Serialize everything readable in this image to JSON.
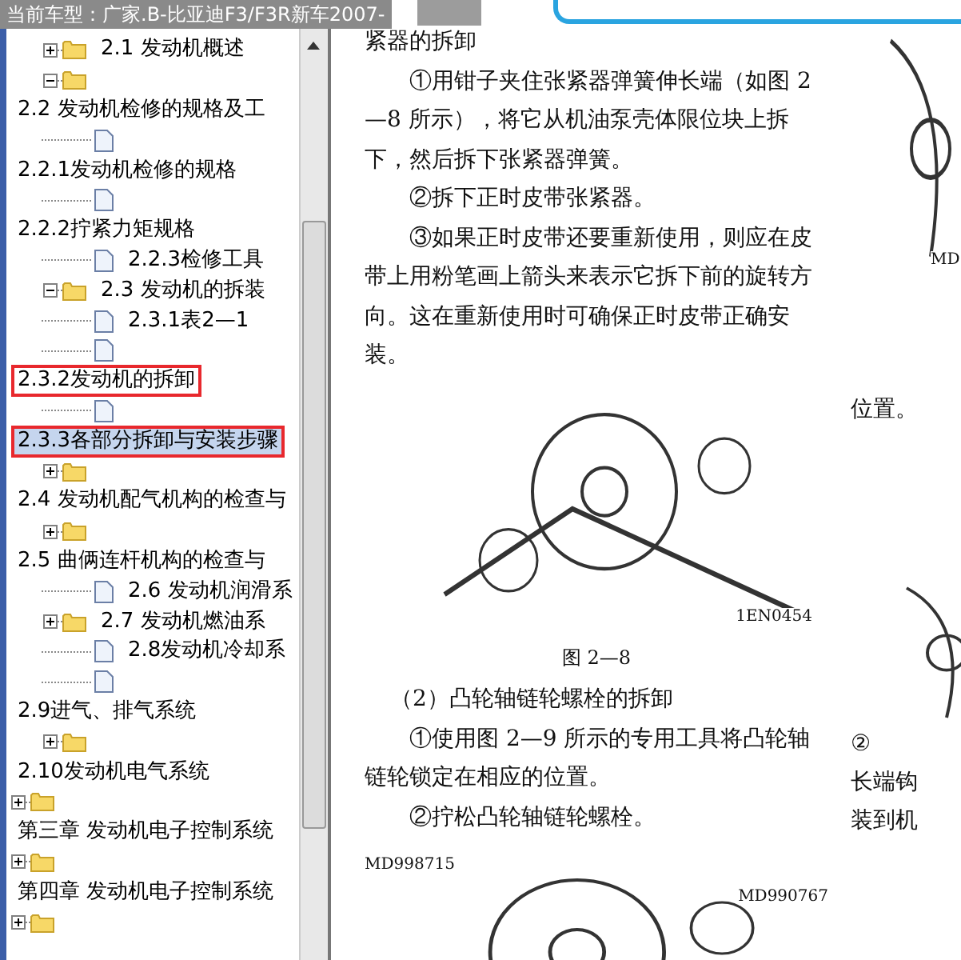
{
  "title_bar": {
    "text": "当前车型：广家.B-比亚迪F3/F3R新车2007-"
  },
  "tree": {
    "rows": [
      {
        "kind": "folder",
        "expanded": false,
        "label": "2.1 发动机概述",
        "selected": false
      },
      {
        "kind": "folder",
        "expanded": true
      },
      {
        "kind": "label",
        "label": "2.2 发动机检修的规格及工",
        "selected": false,
        "outlined": false
      },
      {
        "kind": "doc"
      },
      {
        "kind": "label",
        "label": "2.2.1发动机检修的规格",
        "selected": false,
        "outlined": false
      },
      {
        "kind": "doc"
      },
      {
        "kind": "label",
        "label": "2.2.2拧紧力矩规格",
        "selected": false,
        "outlined": false
      },
      {
        "kind": "doc",
        "label": "2.2.3检修工具",
        "selected": false
      },
      {
        "kind": "folder",
        "expanded": true,
        "label": "2.3 发动机的拆装",
        "selected": false
      },
      {
        "kind": "doc",
        "label": "2.3.1表2—1",
        "selected": false
      },
      {
        "kind": "doc"
      },
      {
        "kind": "label",
        "label": "2.3.2发动机的拆卸",
        "selected": false,
        "outlined": true
      },
      {
        "kind": "doc"
      },
      {
        "kind": "label",
        "label": "2.3.3各部分拆卸与安装步骤",
        "selected": true,
        "outlined": true
      },
      {
        "kind": "folder",
        "expanded": false
      },
      {
        "kind": "label",
        "label": "2.4 发动机配气机构的检查与",
        "selected": false,
        "outlined": false
      },
      {
        "kind": "folder",
        "expanded": false
      },
      {
        "kind": "label",
        "label": "2.5 曲俩连杆机构的检查与",
        "selected": false,
        "outlined": false
      },
      {
        "kind": "doc",
        "label": "2.6 发动机润滑系",
        "selected": false
      },
      {
        "kind": "folder",
        "expanded": false,
        "label": "2.7 发动机燃油系",
        "selected": false
      },
      {
        "kind": "doc",
        "label": "2.8发动机冷却系",
        "selected": false
      },
      {
        "kind": "doc"
      },
      {
        "kind": "label",
        "label": "2.9进气、排气系统",
        "selected": false,
        "outlined": false
      },
      {
        "kind": "folder",
        "expanded": false
      },
      {
        "kind": "label",
        "label": "2.10发动机电气系统",
        "selected": false,
        "outlined": false
      },
      {
        "kind": "root-folder",
        "expanded": false
      },
      {
        "kind": "label",
        "label": "第三章 发动机电子控制系统",
        "selected": false,
        "outlined": false
      },
      {
        "kind": "root-folder",
        "expanded": false
      },
      {
        "kind": "label",
        "label": "第四章 发动机电子控制系统",
        "selected": false,
        "outlined": false
      },
      {
        "kind": "root-folder",
        "expanded": false
      }
    ]
  },
  "document": {
    "main": [
      {
        "kind": "cont",
        "text": "紧器的拆卸"
      },
      {
        "kind": "para",
        "text": "①用钳子夹住张紧器弹簧伸长端（如图 2—8 所示），将它从机油泵壳体限位块上拆下，然后拆下张紧器弹簧。"
      },
      {
        "kind": "para",
        "text": "②拆下正时皮带张紧器。"
      },
      {
        "kind": "para",
        "text": "③如果正时皮带还要重新使用，则应在皮带上用粉笔画上箭头来表示它拆下前的旋转方向。这在重新使用时可确保正时皮带正确安装。"
      },
      {
        "kind": "figure",
        "labels": [
          {
            "text": "1EN0454"
          }
        ]
      },
      {
        "kind": "caption",
        "text": "图 2—8"
      },
      {
        "kind": "heading",
        "text": "（2）凸轮轴链轮螺栓的拆卸"
      },
      {
        "kind": "para",
        "text": "①使用图 2—9 所示的专用工具将凸轮轴链轮锁定在相应的位置。"
      },
      {
        "kind": "para",
        "text": "②拧松凸轮轴链轮螺栓。"
      },
      {
        "kind": "figure",
        "labels": [
          {
            "text": "MD998715"
          },
          {
            "text": "MD990767"
          }
        ]
      }
    ],
    "side": [
      {
        "kind": "figure",
        "labels": [
          {
            "text": "MD"
          }
        ]
      },
      {
        "kind": "text",
        "text": "位置。"
      },
      {
        "kind": "figure"
      },
      {
        "kind": "text",
        "text": "②"
      },
      {
        "kind": "text",
        "text": "长端钩"
      },
      {
        "kind": "text",
        "text": "装到机"
      }
    ]
  }
}
